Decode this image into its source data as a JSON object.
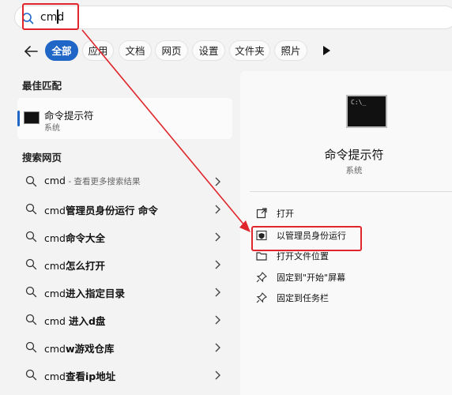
{
  "search": {
    "value": "cmd",
    "placeholder": ""
  },
  "filters": {
    "chips": [
      {
        "label": "全部",
        "active": true
      },
      {
        "label": "应用",
        "active": false
      },
      {
        "label": "文档",
        "active": false
      },
      {
        "label": "网页",
        "active": false
      },
      {
        "label": "设置",
        "active": false
      },
      {
        "label": "文件夹",
        "active": false
      },
      {
        "label": "照片",
        "active": false
      }
    ]
  },
  "best_match": {
    "section_title": "最佳匹配",
    "name": "命令提示符",
    "type": "系统"
  },
  "web_search": {
    "section_title": "搜索网页",
    "items": [
      {
        "query": "cmd",
        "suffix": " - 查看更多搜索结果"
      },
      {
        "query": "cmd",
        "suffix": "管理员身份运行 命令"
      },
      {
        "query": "cmd",
        "suffix": "命令大全"
      },
      {
        "query": "cmd",
        "suffix": "怎么打开"
      },
      {
        "query": "cmd",
        "suffix": "进入指定目录"
      },
      {
        "query": "cmd ",
        "suffix": "进入d盘"
      },
      {
        "query": "cmd",
        "suffix": "w游戏仓库"
      },
      {
        "query": "cmd",
        "suffix": "查看ip地址"
      }
    ]
  },
  "detail": {
    "title": "命令提示符",
    "subtitle": "系统",
    "actions": [
      {
        "label": "打开",
        "icon": "open-icon"
      },
      {
        "label": "以管理员身份运行",
        "icon": "shield-icon"
      },
      {
        "label": "打开文件位置",
        "icon": "folder-icon"
      },
      {
        "label": "固定到\"开始\"屏幕",
        "icon": "pin-icon"
      },
      {
        "label": "固定到任务栏",
        "icon": "pin-icon"
      }
    ]
  },
  "colors": {
    "accent": "#1f66c7",
    "annotation_red": "#e0262b"
  }
}
